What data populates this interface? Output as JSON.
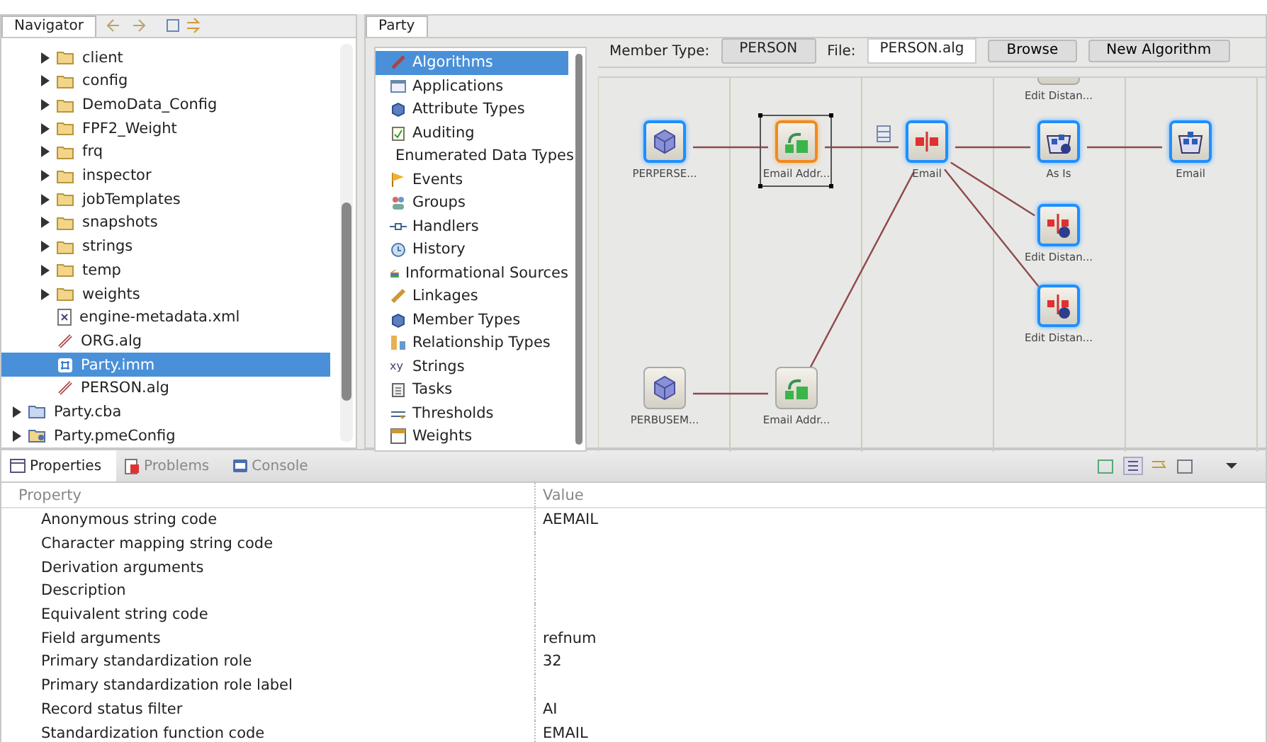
{
  "navigator": {
    "tab": {
      "label": "Navigator",
      "selected": true
    },
    "tree": [
      {
        "children": [
          {
            "label": "client",
            "kind": "folder",
            "expandable": true,
            "selected": false
          },
          {
            "label": "config",
            "kind": "folder",
            "expandable": true,
            "selected": false
          },
          {
            "label": "DemoData_Config",
            "kind": "folder",
            "expandable": true,
            "selected": false
          },
          {
            "label": "FPF2_Weight",
            "kind": "folder",
            "expandable": true,
            "selected": false
          },
          {
            "label": "frq",
            "kind": "folder",
            "expandable": true,
            "selected": false
          },
          {
            "label": "inspector",
            "kind": "folder",
            "expandable": true,
            "selected": false
          },
          {
            "label": "jobTemplates",
            "kind": "folder",
            "expandable": true,
            "selected": false
          },
          {
            "label": "snapshots",
            "kind": "folder",
            "expandable": true,
            "selected": false
          },
          {
            "label": "strings",
            "kind": "folder",
            "expandable": true,
            "selected": false
          },
          {
            "label": "temp",
            "kind": "folder",
            "expandable": true,
            "selected": false
          },
          {
            "label": "weights",
            "kind": "folder",
            "expandable": true,
            "selected": false
          },
          {
            "label": "engine-metadata.xml",
            "kind": "xml",
            "expandable": false,
            "selected": false
          },
          {
            "label": "ORG.alg",
            "kind": "alg",
            "expandable": false,
            "selected": false
          },
          {
            "label": "Party.imm",
            "kind": "imm",
            "expandable": false,
            "selected": true
          },
          {
            "label": "PERSON.alg",
            "kind": "alg",
            "expandable": false,
            "selected": false
          }
        ]
      },
      {
        "label": "Party.cba",
        "kind": "cba",
        "expandable": true,
        "selected": false
      },
      {
        "label": "Party.pmeConfig",
        "kind": "pme",
        "expandable": true,
        "selected": false
      }
    ]
  },
  "editor": {
    "tab": {
      "label": "Party",
      "selected": true
    },
    "categories": [
      {
        "label": "Algorithms",
        "kind": "alg",
        "selected": true
      },
      {
        "label": "Applications",
        "kind": "app",
        "selected": false
      },
      {
        "label": "Attribute Types",
        "kind": "cube",
        "selected": false
      },
      {
        "label": "Auditing",
        "kind": "audit",
        "selected": false
      },
      {
        "label": "Enumerated Data Types",
        "kind": "enum",
        "selected": false
      },
      {
        "label": "Events",
        "kind": "flag",
        "selected": false
      },
      {
        "label": "Groups",
        "kind": "group",
        "selected": false
      },
      {
        "label": "Handlers",
        "kind": "handler",
        "selected": false
      },
      {
        "label": "History",
        "kind": "history",
        "selected": false
      },
      {
        "label": "Informational Sources",
        "kind": "books",
        "selected": false
      },
      {
        "label": "Linkages",
        "kind": "link",
        "selected": false
      },
      {
        "label": "Member Types",
        "kind": "cube",
        "selected": false
      },
      {
        "label": "Relationship Types",
        "kind": "rel",
        "selected": false
      },
      {
        "label": "Strings",
        "kind": "xy",
        "selected": false
      },
      {
        "label": "Tasks",
        "kind": "task",
        "selected": false
      },
      {
        "label": "Thresholds",
        "kind": "threshold",
        "selected": false
      },
      {
        "label": "Weights",
        "kind": "weights",
        "selected": false
      }
    ],
    "toolbar": {
      "member_type_label": "Member Type:",
      "member_type": "PERSON",
      "file_label": "File:",
      "file": "PERSON.alg",
      "buttons": [
        "Browse",
        "New Algorithm"
      ]
    },
    "diagram": {
      "nodes": [
        {
          "label": "PERPERSE...",
          "kind": "source",
          "highlighted": true,
          "selected": false
        },
        {
          "label": "Email Addr...",
          "kind": "derive",
          "highlighted": true,
          "selected": true
        },
        {
          "label": "Email",
          "kind": "match",
          "highlighted": true,
          "selected": false
        },
        {
          "label": "As Is",
          "kind": "asis",
          "highlighted": true,
          "selected": false
        },
        {
          "label": "Email",
          "kind": "output",
          "highlighted": true,
          "selected": false
        },
        {
          "label": "Edit Distan...",
          "kind": "editdist",
          "highlighted": false,
          "selected": false
        },
        {
          "label": "Edit Distan...",
          "kind": "editdist",
          "highlighted": true,
          "selected": false
        },
        {
          "label": "Edit Distan...",
          "kind": "editdist",
          "highlighted": true,
          "selected": false
        },
        {
          "label": "PERBUSEM...",
          "kind": "source",
          "highlighted": false,
          "selected": false
        },
        {
          "label": "Email Addr...",
          "kind": "derive",
          "highlighted": false,
          "selected": false
        }
      ]
    }
  },
  "properties": {
    "tabs": [
      {
        "label": "Properties",
        "selected": true
      },
      {
        "label": "Problems",
        "selected": false
      },
      {
        "label": "Console",
        "selected": false
      }
    ],
    "columns": [
      "Property",
      "Value"
    ],
    "rows": [
      {
        "property": "Anonymous string code",
        "value": "AEMAIL"
      },
      {
        "property": "Character mapping string code"
      },
      {
        "property": "Derivation arguments"
      },
      {
        "property": "Description"
      },
      {
        "property": "Equivalent string code"
      },
      {
        "property": "Field arguments",
        "value": "refnum"
      },
      {
        "property": "Primary standardization role",
        "value": "32"
      },
      {
        "property": "Primary standardization role label"
      },
      {
        "property": "Record status filter",
        "value": "AI"
      },
      {
        "property": "Standardization function code",
        "value": "EMAIL"
      }
    ]
  }
}
